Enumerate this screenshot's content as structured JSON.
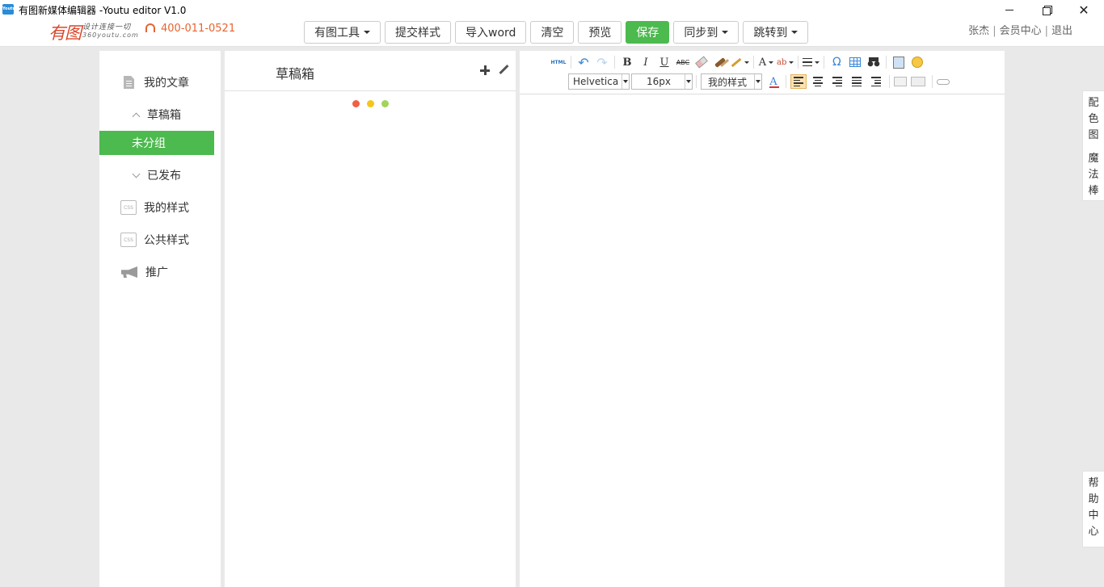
{
  "window": {
    "title": "有图新媒体编辑器 -Youtu editor V1.0",
    "app_icon_text": "Youtu",
    "minimize_label": "",
    "maximize_label": "",
    "close_label": "✕"
  },
  "header": {
    "logo_mark": "有图",
    "logo_slogan": "设计连接一切",
    "logo_url": "360youtu.com",
    "phone": "400-011-0521",
    "toolbar": [
      {
        "label": "有图工具",
        "dropdown": true
      },
      {
        "label": "提交样式"
      },
      {
        "label": "导入word"
      },
      {
        "label": "清空"
      },
      {
        "label": "预览"
      },
      {
        "label": "保存",
        "primary": true
      },
      {
        "label": "同步到",
        "dropdown": true
      },
      {
        "label": "跳转到",
        "dropdown": true
      }
    ],
    "user": {
      "name": "张杰",
      "member_center": "会员中心",
      "logout": "退出",
      "separator": "|"
    }
  },
  "sidebar": {
    "my_articles": "我的文章",
    "drafts": "草稿箱",
    "ungrouped": "未分组",
    "published": "已发布",
    "my_styles": "我的样式",
    "public_styles": "公共样式",
    "promotion": "推广",
    "css_icon_text": "CSS"
  },
  "drafts_panel": {
    "title": "草稿箱",
    "dot_colors": [
      "#f16043",
      "#f5c518",
      "#a3d35a"
    ]
  },
  "editor": {
    "html_label": "HTML",
    "undo": "↶",
    "redo": "↷",
    "bold": "B",
    "italic": "I",
    "underline": "U",
    "strike": "ABC",
    "font_color_glyph": "A",
    "highlight_glyph": "ab",
    "omega": "Ω",
    "font_family": "Helvetica",
    "font_size": "16px",
    "my_style_select": "我的样式",
    "clear_format_glyph": "A"
  },
  "right_tabs": {
    "color_scheme": [
      "配",
      "色",
      "图"
    ],
    "magic_wand": [
      "魔",
      "法",
      "棒"
    ],
    "help_center": [
      "帮",
      "助",
      "中",
      "心"
    ]
  },
  "colors": {
    "accent_green": "#4cba4e",
    "phone_orange": "#e8632f",
    "toolbar_blue": "#3a86d6"
  }
}
